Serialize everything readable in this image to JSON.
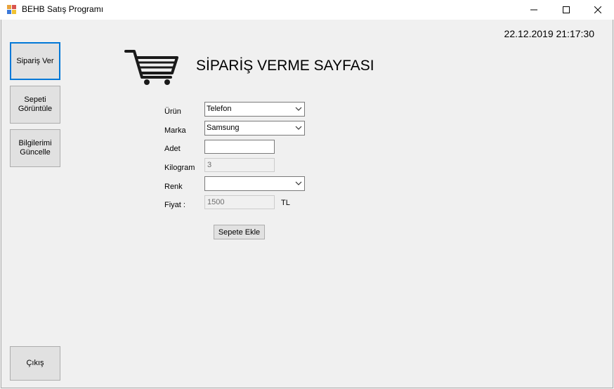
{
  "window": {
    "title": "BEHB Satış Programı",
    "icons": {
      "app": "app-icon",
      "minimize": "minimize-icon",
      "maximize": "maximize-icon",
      "close": "close-icon"
    }
  },
  "header": {
    "datetime": "22.12.2019 21:17:30",
    "page_title": "SİPARİŞ VERME SAYFASI",
    "icon": "shopping-cart-icon"
  },
  "sidebar": {
    "items": [
      {
        "label": "Sipariş Ver",
        "active": true
      },
      {
        "label": "Sepeti\nGörüntüle",
        "active": false
      },
      {
        "label": "Bilgilerimi\nGüncelle",
        "active": false
      },
      {
        "label": "Çıkış",
        "active": false
      }
    ]
  },
  "form": {
    "urun": {
      "label": "Ürün",
      "value": "Telefon"
    },
    "marka": {
      "label": "Marka",
      "value": "Samsung"
    },
    "adet": {
      "label": "Adet",
      "value": ""
    },
    "kilogram": {
      "label": "Kilogram",
      "value": "3"
    },
    "renk": {
      "label": "Renk",
      "value": ""
    },
    "fiyat": {
      "label": "Fiyat :",
      "value": "1500",
      "unit": "TL"
    },
    "add_button": "Sepete Ekle"
  },
  "colors": {
    "accent": "#0078d7",
    "background": "#f0f0f0"
  }
}
